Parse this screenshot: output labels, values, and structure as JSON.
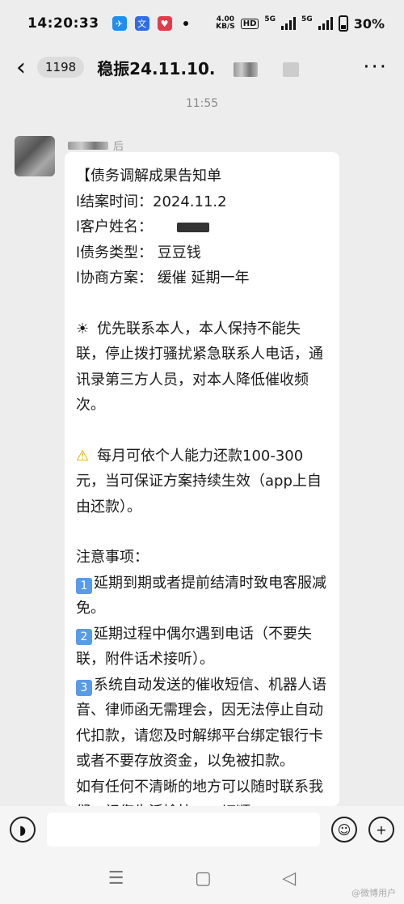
{
  "status": {
    "time": "14:20:33",
    "net_speed_value": "4.00",
    "net_speed_unit": "KB/S",
    "hd": "HD",
    "sig1": "5G",
    "sig2": "5G",
    "battery": "30%"
  },
  "header": {
    "unread": "1198",
    "title": "稳振24.11.10."
  },
  "chat": {
    "timestamp": "11:55",
    "sender_suffix": "后",
    "message": {
      "lines_a": [
        "【债务调解成果告知单",
        "l结案时间：2024.11.2",
        "l客户姓名：",
        "l债务类型：  豆豆钱",
        "l协商方案：  缓催  延期一年"
      ],
      "para1": "优先联系本人，本人保持不能失联，停止拨打骚扰紧急联系人电话，通讯录第三方人员，对本人降低催收频次。",
      "para2": "每月可依个人能力还款100-300元，当可保证方案持续生效（app上自由还款）。",
      "notes_title": "注意事项：",
      "notes": [
        {
          "num": "1",
          "text": "延期到期或者提前结清时致电客服减免。"
        },
        {
          "num": "2",
          "text": "延期过程中偶尔遇到电话（不要失联，附件话术接听）。"
        },
        {
          "num": "3",
          "text": "系统自动发送的催收短信、机器人语音、律师函无需理会，因无法停止自动代扣款，请您及时解绑平台绑定银行卡或者不要存放资金，以免被扣款。"
        }
      ],
      "closing": "如有任何不清晰的地方可以随时联系我们，祝您生活愉快，一切顺"
    }
  },
  "icons": {
    "sun": "sun-emoji",
    "warning": "warning-emoji"
  },
  "watermark": "@微博用户"
}
